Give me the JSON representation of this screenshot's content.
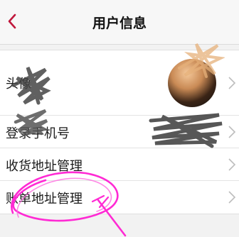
{
  "nav": {
    "title": "用户信息",
    "back_icon": "chevron-left-icon",
    "accent_color": "#c0183c"
  },
  "rows": [
    {
      "label": "头像",
      "value_type": "avatar"
    },
    {
      "label": "登录手机号",
      "value": "(redacted)"
    },
    {
      "label": "收货地址管理"
    },
    {
      "label": "账单地址管理"
    }
  ],
  "annotation_color": "#ff2ad4"
}
